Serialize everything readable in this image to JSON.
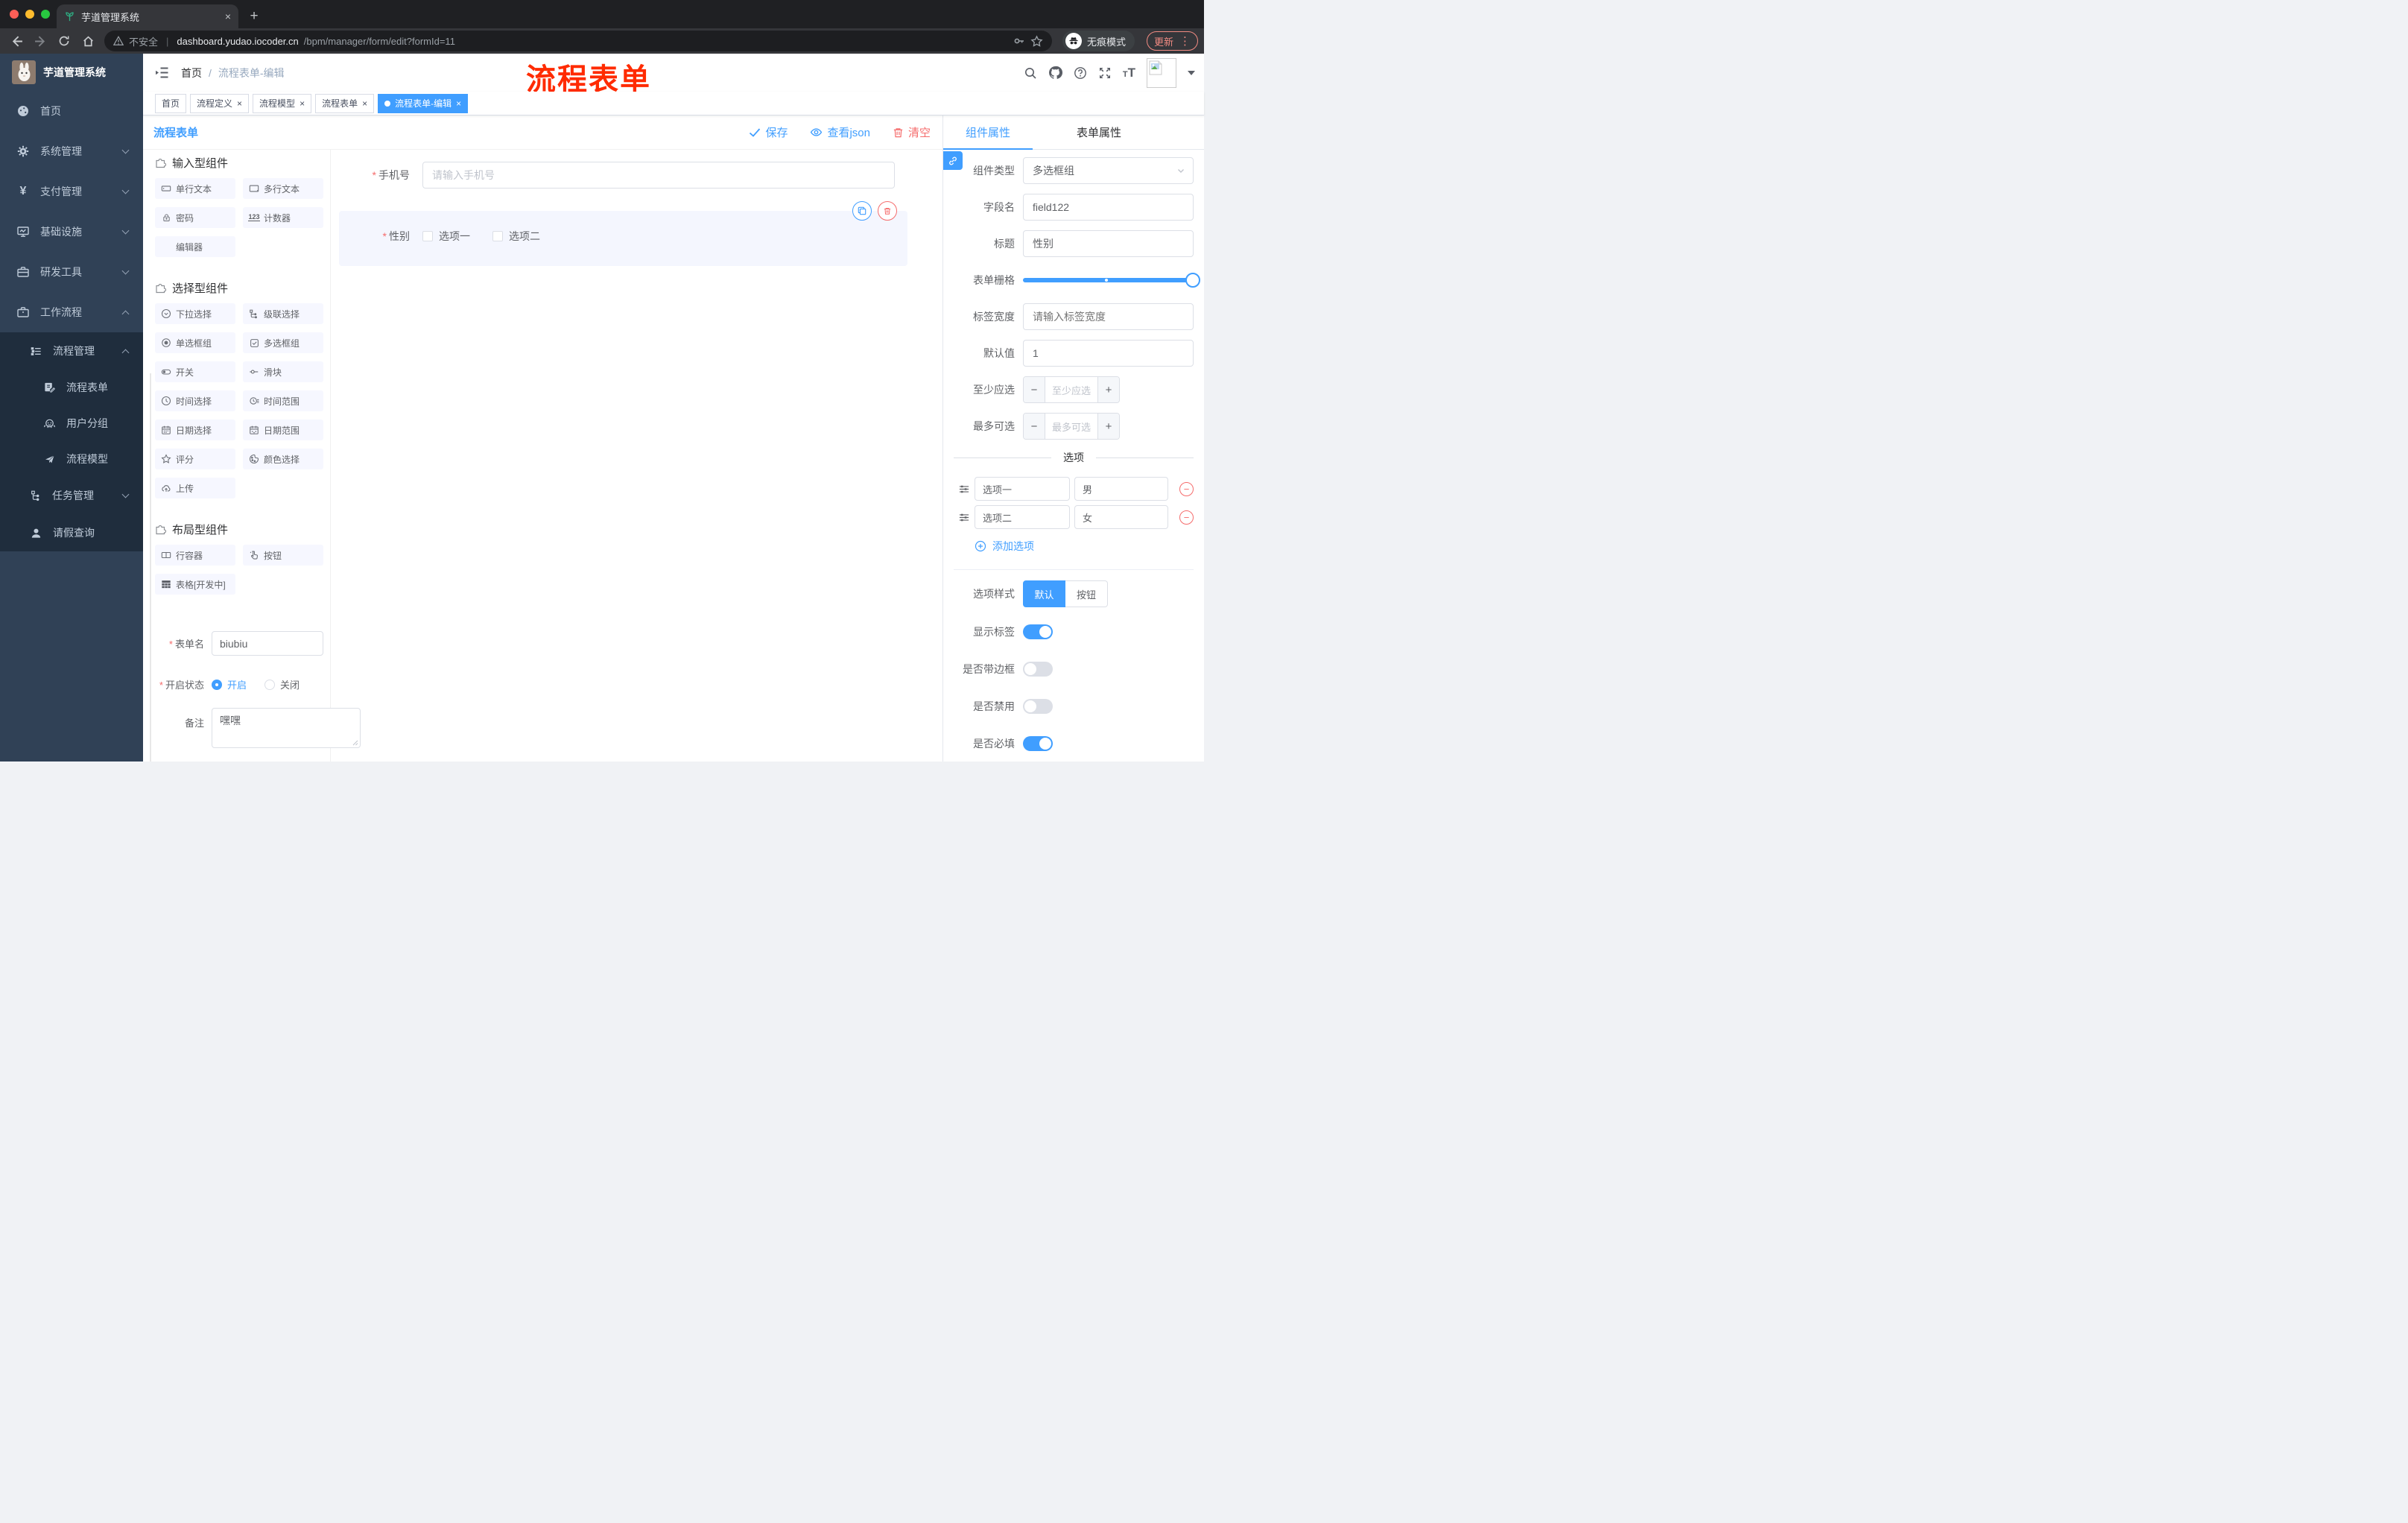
{
  "browser": {
    "tab_title": "芋道管理系统",
    "security_label": "不安全",
    "url_host": "dashboard.yudao.iocoder.cn",
    "url_path": "/bpm/manager/form/edit?formId=11",
    "incognito_label": "无痕模式",
    "update_label": "更新"
  },
  "annotation": {
    "text": "流程表单",
    "color": "#FF2B00"
  },
  "sidebar": {
    "logo_title": "芋道管理系统",
    "items": [
      {
        "label": "首页",
        "icon": "dashboard-icon"
      },
      {
        "label": "系统管理",
        "icon": "gear-icon",
        "arrow": "down"
      },
      {
        "label": "支付管理",
        "icon": "yen-icon",
        "arrow": "down"
      },
      {
        "label": "基础设施",
        "icon": "monitor-icon",
        "arrow": "down"
      },
      {
        "label": "研发工具",
        "icon": "briefcase-icon",
        "arrow": "down"
      },
      {
        "label": "工作流程",
        "icon": "briefcase-icon",
        "arrow": "up"
      },
      {
        "label": "流程管理",
        "icon": "list-tree-icon",
        "arrow": "up"
      },
      {
        "label": "流程表单",
        "icon": "document-edit-icon"
      },
      {
        "label": "用户分组",
        "icon": "robot-icon"
      },
      {
        "label": "流程模型",
        "icon": "paper-plane-icon"
      },
      {
        "label": "任务管理",
        "icon": "tree-icon",
        "arrow": "down"
      },
      {
        "label": "请假查询",
        "icon": "user-icon"
      }
    ]
  },
  "navbar": {
    "breadcrumb_home": "首页",
    "breadcrumb_current": "流程表单-编辑"
  },
  "tags": {
    "items": [
      {
        "label": "首页",
        "closable": false,
        "active": false
      },
      {
        "label": "流程定义",
        "closable": true,
        "active": false
      },
      {
        "label": "流程模型",
        "closable": true,
        "active": false
      },
      {
        "label": "流程表单",
        "closable": true,
        "active": false
      },
      {
        "label": "流程表单-编辑",
        "closable": true,
        "active": true
      }
    ]
  },
  "toolbar": {
    "title": "流程表单",
    "save_label": "保存",
    "view_json_label": "查看json",
    "clear_label": "清空"
  },
  "palette": {
    "sections": [
      {
        "title": "输入型组件",
        "items": [
          {
            "label": "单行文本",
            "icon": "input-icon"
          },
          {
            "label": "多行文本",
            "icon": "textarea-icon"
          },
          {
            "label": "密码",
            "icon": "lock-icon"
          },
          {
            "label": "计数器",
            "icon": "number-icon"
          },
          {
            "label": "编辑器",
            "icon": "none"
          }
        ]
      },
      {
        "title": "选择型组件",
        "items": [
          {
            "label": "下拉选择",
            "icon": "select-icon"
          },
          {
            "label": "级联选择",
            "icon": "cascader-icon"
          },
          {
            "label": "单选框组",
            "icon": "radio-icon"
          },
          {
            "label": "多选框组",
            "icon": "checkbox-icon"
          },
          {
            "label": "开关",
            "icon": "switch-icon"
          },
          {
            "label": "滑块",
            "icon": "slider-icon"
          },
          {
            "label": "时间选择",
            "icon": "time-icon"
          },
          {
            "label": "时间范围",
            "icon": "time-range-icon"
          },
          {
            "label": "日期选择",
            "icon": "date-icon"
          },
          {
            "label": "日期范围",
            "icon": "date-range-icon"
          },
          {
            "label": "评分",
            "icon": "star-icon"
          },
          {
            "label": "颜色选择",
            "icon": "color-icon"
          },
          {
            "label": "上传",
            "icon": "upload-icon"
          }
        ]
      },
      {
        "title": "布局型组件",
        "items": [
          {
            "label": "行容器",
            "icon": "row-icon"
          },
          {
            "label": "按钮",
            "icon": "button-icon"
          },
          {
            "label": "表格[开发中]",
            "icon": "table-icon"
          }
        ]
      }
    ]
  },
  "meta_form": {
    "form_name_label": "表单名",
    "form_name_value": "biubiu",
    "status_label": "开启状态",
    "status_on": "开启",
    "status_off": "关闭",
    "status_value": "开启",
    "remark_label": "备注",
    "remark_value": "嘿嘿"
  },
  "canvas": {
    "phone": {
      "label": "手机号",
      "placeholder": "请输入手机号",
      "required": true
    },
    "gender": {
      "label": "性别",
      "required": true,
      "option1": "选项一",
      "option2": "选项二"
    }
  },
  "inspector": {
    "tab_component": "组件属性",
    "tab_form": "表单属性",
    "component_type_label": "组件类型",
    "component_type_value": "多选框组",
    "field_name_label": "字段名",
    "field_name_value": "field122",
    "title_label": "标题",
    "title_value": "性别",
    "grid_label": "表单栅格",
    "grid_value_percent": 100,
    "grid_stop_percent": 48,
    "label_width_label": "标签宽度",
    "label_width_placeholder": "请输入标签宽度",
    "default_label": "默认值",
    "default_value": "1",
    "min_label": "至少应选",
    "min_placeholder": "至少应选",
    "max_label": "最多可选",
    "max_placeholder": "最多可选",
    "options_divider": "选项",
    "options": [
      {
        "label": "选项一",
        "value": "男"
      },
      {
        "label": "选项二",
        "value": "女"
      }
    ],
    "add_option_label": "添加选项",
    "option_style_label": "选项样式",
    "option_style_default": "默认",
    "option_style_button": "按钮",
    "option_style_value": "默认",
    "show_label_label": "显示标签",
    "show_label_value": true,
    "border_label": "是否带边框",
    "border_value": false,
    "disabled_label": "是否禁用",
    "disabled_value": false,
    "required_label": "是否必填",
    "required_value": true
  },
  "colors": {
    "accent": "#409EFF",
    "danger": "#F56C6C",
    "sidebar_bg": "#304156",
    "submenu_bg": "#1F2D3D",
    "active_tag": "#409EFF"
  }
}
